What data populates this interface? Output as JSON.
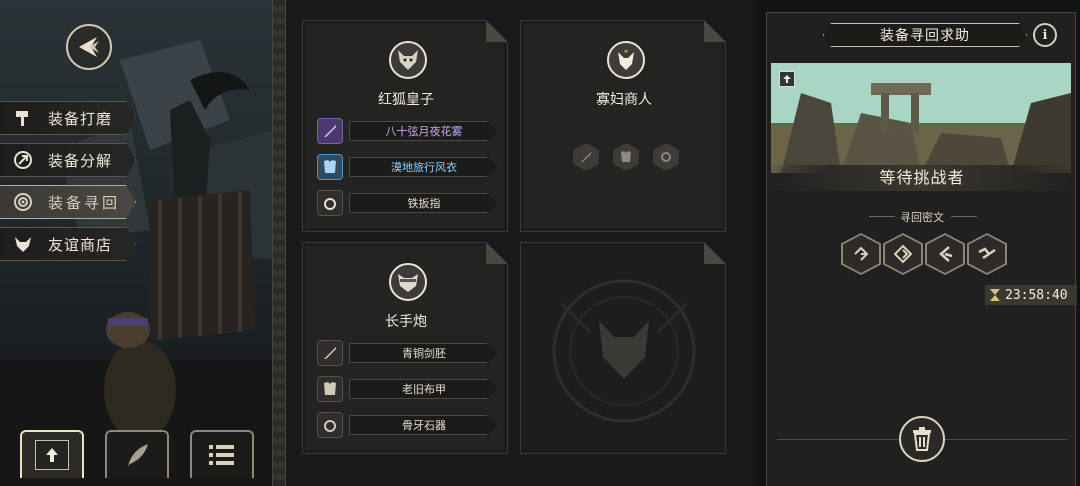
{
  "menu": {
    "items": [
      {
        "label": "装备打磨",
        "icon": "hammer-icon"
      },
      {
        "label": "装备分解",
        "icon": "dismantle-icon"
      },
      {
        "label": "装备寻回",
        "icon": "target-icon"
      },
      {
        "label": "友谊商店",
        "icon": "fox-icon"
      }
    ],
    "active_index": 2
  },
  "bottom_tabs": [
    {
      "icon": "upload-icon"
    },
    {
      "icon": "feather-icon"
    },
    {
      "icon": "list-icon"
    }
  ],
  "cards": [
    {
      "name": "红狐皇子",
      "avatar": "wolf-portrait-icon",
      "equipment": [
        {
          "label": "八十弦月夜花雾",
          "icon": "sword-icon",
          "color": "#c9a9f0"
        },
        {
          "label": "漠地旅行风衣",
          "icon": "armor-icon",
          "color": "#8fd0ff"
        },
        {
          "label": "铁扳指",
          "icon": "ring-icon",
          "color": "#e5dfd0"
        }
      ]
    },
    {
      "name": "寡妇商人",
      "avatar": "skunk-portrait-icon",
      "empty_slots": [
        "sword-slot-icon",
        "armor-slot-icon",
        "ring-slot-icon"
      ]
    },
    {
      "name": "长手炮",
      "avatar": "cat-portrait-icon",
      "equipment": [
        {
          "label": "青铜剑胚",
          "icon": "sword-icon",
          "color": "#e5dfd0"
        },
        {
          "label": "老旧布甲",
          "icon": "armor-icon",
          "color": "#e5dfd0"
        },
        {
          "label": "骨牙石器",
          "icon": "ring-icon",
          "color": "#e5dfd0"
        }
      ]
    },
    {
      "locked": true,
      "emblem": "fox-emblem-icon"
    }
  ],
  "panel": {
    "title": "装备寻回求助",
    "info": "i",
    "status": "等待挑战者",
    "secret_label": "寻回密文",
    "runes": [
      "rune-1-icon",
      "rune-2-icon",
      "rune-3-icon",
      "rune-4-icon"
    ],
    "timer": "23:58:40"
  }
}
